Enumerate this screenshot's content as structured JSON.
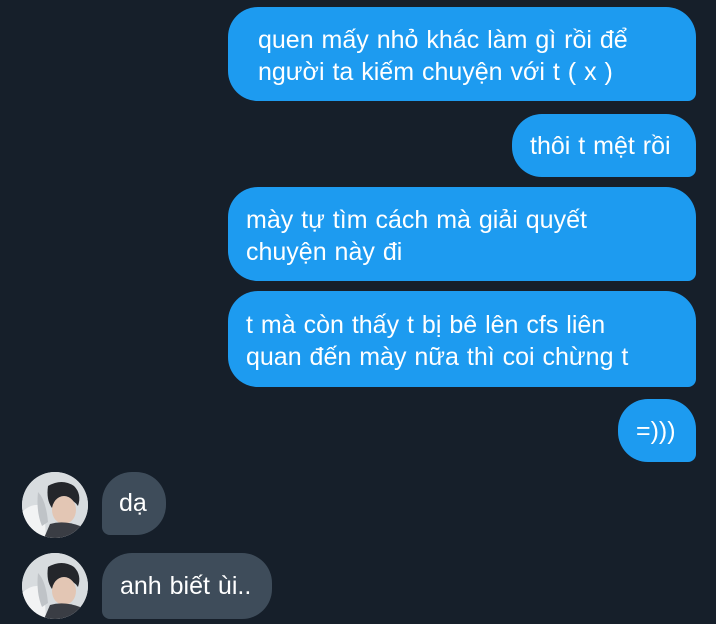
{
  "messages": [
    {
      "sender": "me",
      "text": "quen mấy nhỏ khác làm gì rồi để\nngười ta kiếm chuyện với t ( x )"
    },
    {
      "sender": "me",
      "text": "thôi t mệt rồi"
    },
    {
      "sender": "me",
      "text": "mày tự tìm cách mà giải quyết\nchuyện này đi"
    },
    {
      "sender": "me",
      "text": "t mà còn thấy t bị bê lên cfs liên\nquan đến mày nữa thì coi chừng t"
    },
    {
      "sender": "me",
      "text": "=)))"
    },
    {
      "sender": "other",
      "text": "dạ"
    },
    {
      "sender": "other",
      "text": "anh biết ùi.."
    }
  ],
  "colors": {
    "background": "#161f2a",
    "outgoing_bubble": "#1d9bf0",
    "incoming_bubble": "#3e4c5a",
    "text": "#ffffff"
  },
  "icons": {
    "avatar": "contact-avatar-photo"
  }
}
